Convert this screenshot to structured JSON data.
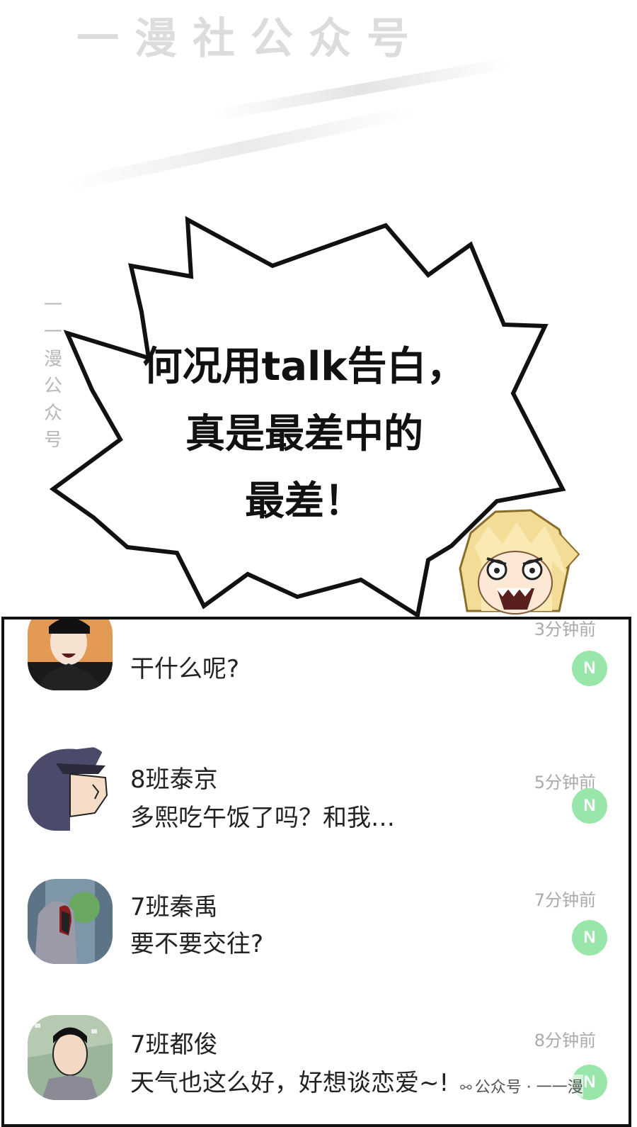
{
  "watermark": {
    "top": "一漫社公众号",
    "vertical": "一一漫公众号",
    "footer": "公众号 · 一一漫"
  },
  "speech": {
    "lines": [
      "何况用talk告白，",
      "真是最差中的",
      "最差！"
    ]
  },
  "chat": {
    "items": [
      {
        "name": "",
        "message": "干什么呢?",
        "time": "3分钟前",
        "badge": "N"
      },
      {
        "name": "8班泰京",
        "message": "多熙吃午饭了吗？和我…",
        "time": "5分钟前",
        "badge": "N"
      },
      {
        "name": "7班秦禹",
        "message": "要不要交往?",
        "time": "7分钟前",
        "badge": "N"
      },
      {
        "name": "7班都俊",
        "message": "天气也这么好，好想谈恋爱~!",
        "time": "8分钟前",
        "badge": "N"
      }
    ]
  },
  "colors": {
    "badge": "#98e6a9",
    "time": "#aaaaaa",
    "border": "#111111"
  },
  "icons": {
    "footer": "wechat-icon"
  }
}
